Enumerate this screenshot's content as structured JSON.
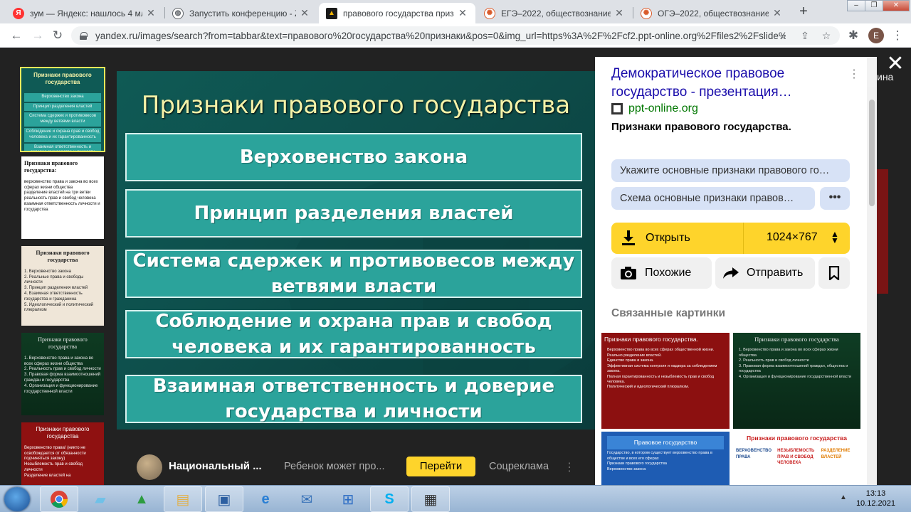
{
  "browser": {
    "tabs": [
      {
        "title": "зум — Яндекс: нашлось 4 млн р",
        "fav": "Я",
        "fav_color": "#ff3333",
        "active": false
      },
      {
        "title": "Запустить конференцию - Zoo",
        "fav": "◍",
        "fav_color": "#5f6368",
        "active": false
      },
      {
        "title": "правового государства призна",
        "fav": "▲",
        "fav_color": "#e6a100",
        "active": true
      },
      {
        "title": "ЕГЭ–2022, обществознание: за",
        "fav": "✺",
        "fav_color": "#d95b2b",
        "active": false
      },
      {
        "title": "ОГЭ–2022, обществознание: за",
        "fav": "✺",
        "fav_color": "#d95b2b",
        "active": false
      }
    ],
    "url": "yandex.ru/images/search?from=tabbar&text=правового%20государства%20признаки&pos=0&img_url=https%3A%2F%2Fcf2.ppt-online.org%2Ffiles2%2Fslide%...",
    "profile_initial": "E"
  },
  "slide": {
    "title": "Признаки правового государства",
    "items": [
      "Верховенство закона",
      "Принцип разделения властей",
      "Система сдержек и противовесов между ветвями власти",
      "Соблюдение и охрана прав и свобод человека и их гарантированность",
      "Взаимная ответственность и доверие государства и личности"
    ]
  },
  "thumbnails": [
    {
      "head": "Признаки правового государства",
      "lines": [
        "Верховенство закона",
        "Принцип разделения властей",
        "Система сдержек и противовесов между ветвями власти",
        "Соблюдение и охрана прав и свобод человека и их гарантированность",
        "Взаимная ответственность и доверие государства и личности"
      ]
    },
    {
      "head": "Признаки правового государства:",
      "lines": [
        "верховенство права и закона во всех сферах жизни общества",
        "разделение властей на три ветви",
        "реальность прав и свобод человека",
        "взаимная ответственность личности и государства"
      ]
    },
    {
      "head": "Признаки правового государства",
      "lines": [
        "1. Верховенство закона",
        "2. Реальные права и свободы личности",
        "3. Принцип разделения властей",
        "4. Взаимная ответственность государства и гражданина",
        "5. Идеологический и политический плюрализм"
      ]
    },
    {
      "head": "Признаки правового государства",
      "lines": [
        "1. Верховенство права и закона во всех сферах жизни общества",
        "2. Реальность прав и свобод личности",
        "3. Правовая форма взаимоотношений граждан и государства",
        "4. Организация и функционирование государственной власти"
      ]
    },
    {
      "head": "Признаки правового государства",
      "lines": [
        "Верховенство права! (никто не освобождается от обязанности подчиняться закону)",
        "Незыблемость прав и свобод личности",
        "Разделение властей на"
      ]
    }
  ],
  "ad": {
    "title": "Национальный ...",
    "text": "Ребенок может про...",
    "button": "Перейти",
    "label": "Соцреклама"
  },
  "panel": {
    "title": "Демократическое правовое государство - презентация…",
    "source": "ppt-online.org",
    "description": "Признаки правового государства.",
    "tags": [
      "Укажите основные признаки правового го…",
      "Схема основные признаки правов…"
    ],
    "open_label": "Открыть",
    "size": "1024×767",
    "similar_label": "Похожие",
    "share_label": "Отправить",
    "related_title": "Связанные картинки",
    "related": [
      {
        "head": "Признаки правового государства.",
        "lines": [
          "Верховенство права во всех сферах общественной жизни.",
          "Реально разделение властей.",
          "Единство права и закона.",
          "Эффективная система контроля и надзора за соблюдением закона.",
          "Полная гарантированность и незыблемость прав и свобод человека.",
          "Политический и идеологический плюрализм."
        ]
      },
      {
        "head": "Признаки правового государства",
        "lines": [
          "1. Верховенство права и закона во всех сферах жизни общества",
          "2. Реальность прав и свобод личности",
          "3. Правовая форма взаимоотношений граждан, общества и государства",
          "4. Организация и функционирование государственной власти"
        ]
      },
      {
        "head": "Правовое государство",
        "lines": [
          "Государство, в котором существует верховенство права в обществе и всех его сферах",
          "Признаки правового государства",
          "Верховенство закона"
        ]
      },
      {
        "head": "Признаки правового государства",
        "lines": [
          "ВЕРХОВЕНСТВО ПРАВА",
          "НЕЗЫБЛЕМОСТЬ ПРАВ И СВОБОД ЧЕЛОВЕКА",
          "РАЗДЕЛЕНИЕ ВЛАСТЕЙ"
        ]
      }
    ]
  },
  "edge_text": "ина",
  "taskbar": {
    "time": "13:13",
    "date": "10.12.2021"
  },
  "colors": {
    "slide_bg": "#0f5a55",
    "slide_box": "#2ba39b",
    "slide_title": "#f4f2a8",
    "accent_yellow": "#fed42b",
    "link_blue": "#1a0dab",
    "source_green": "#007700"
  }
}
